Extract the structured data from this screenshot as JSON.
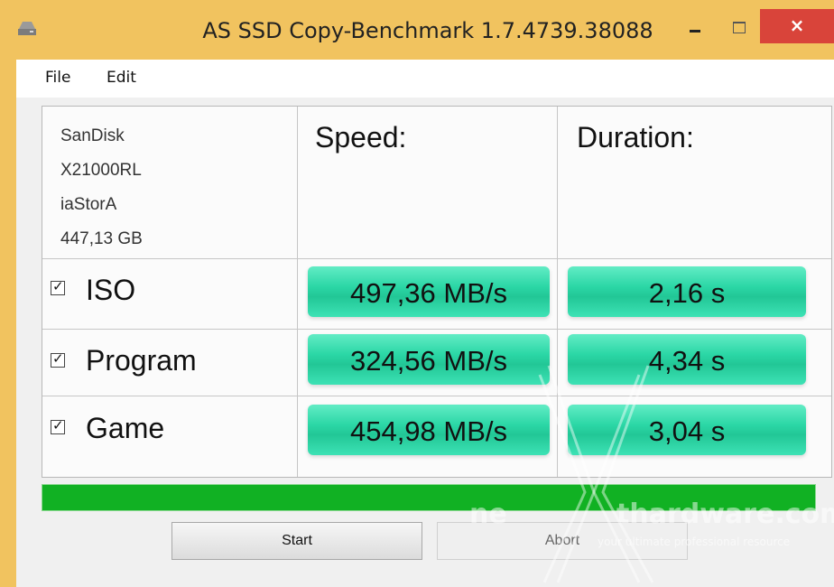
{
  "window": {
    "title": "AS SSD Copy-Benchmark 1.7.4739.38088",
    "close_label": "×"
  },
  "menu": {
    "file": "File",
    "edit": "Edit"
  },
  "drive": {
    "model": "SanDisk",
    "firmware": "X21000RL",
    "driver": "iaStorA",
    "capacity": "447,13 GB"
  },
  "columns": {
    "speed": "Speed:",
    "duration": "Duration:"
  },
  "tests": [
    {
      "label": "ISO",
      "checked": true,
      "speed": "497,36 MB/s",
      "duration": "2,16 s"
    },
    {
      "label": "Program",
      "checked": true,
      "speed": "324,56 MB/s",
      "duration": "4,34 s"
    },
    {
      "label": "Game",
      "checked": true,
      "speed": "454,98 MB/s",
      "duration": "3,04 s"
    }
  ],
  "progress": {
    "value_percent": 100,
    "color": "#11b123"
  },
  "buttons": {
    "start": "Start",
    "abort": "Abort"
  },
  "watermark": {
    "brand_left": "ne",
    "brand_right": "thardware.com",
    "tagline": "your ultimate professional resource"
  },
  "colors": {
    "titlebar": "#f1c35f",
    "result_fill": "#2bd7a6",
    "close": "#d9443a"
  }
}
